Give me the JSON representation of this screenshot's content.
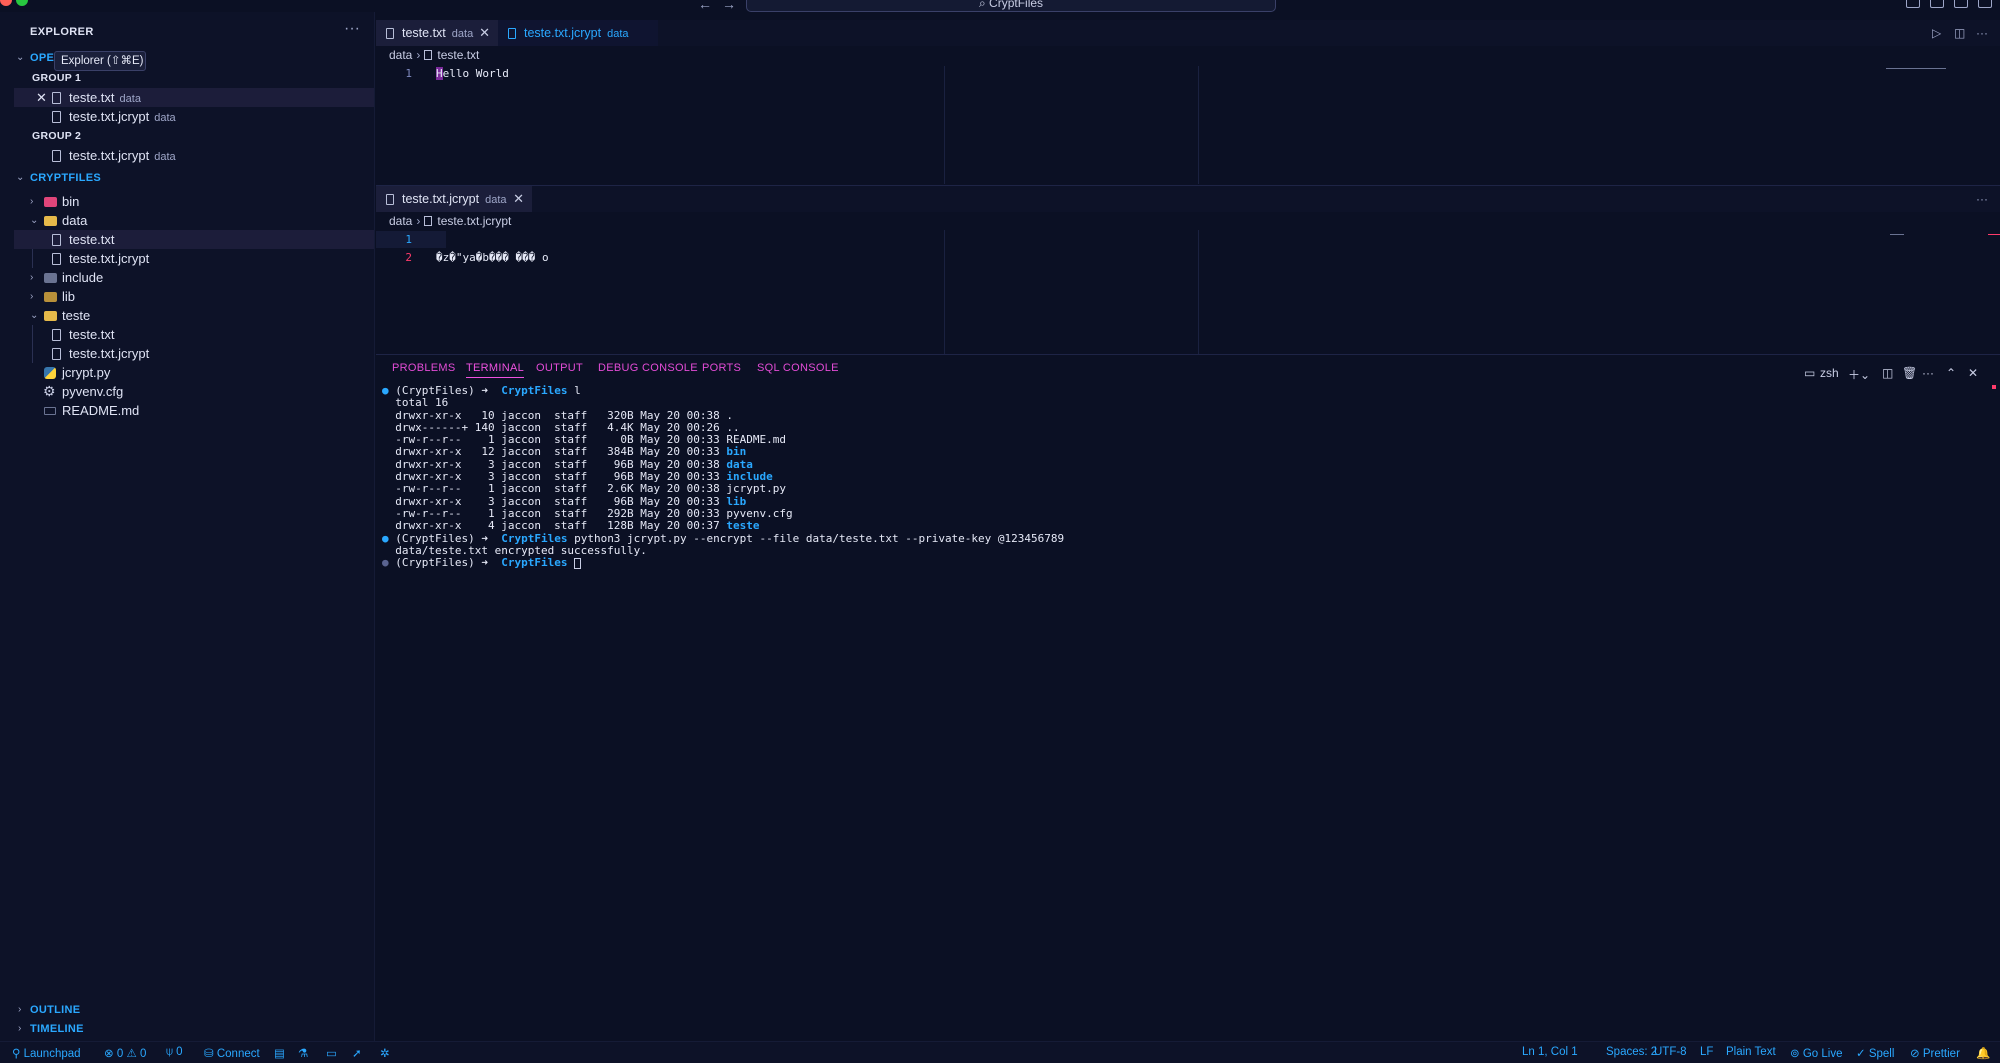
{
  "titlebar": {
    "search": "CryptFiles",
    "back_arrow": "←",
    "forward_arrow": "→"
  },
  "sidebar": {
    "title": "EXPLORER",
    "more": "···",
    "tooltip": "Explorer (⇧⌘E)",
    "open_editors": {
      "title": "OPEN EDITORS",
      "groups": [
        {
          "label": "GROUP 1",
          "items": [
            {
              "name": "teste.txt",
              "desc": "data"
            },
            {
              "name": "teste.txt.jcrypt",
              "desc": "data"
            }
          ]
        },
        {
          "label": "GROUP 2",
          "items": [
            {
              "name": "teste.txt.jcrypt",
              "desc": "data"
            }
          ]
        }
      ]
    },
    "workspace": {
      "title": "CRYPTFILES",
      "items": [
        "bin",
        "data",
        "teste.txt",
        "teste.txt.jcrypt",
        "include",
        "lib",
        "teste",
        "teste.txt",
        "teste.txt.jcrypt",
        "jcrypt.py",
        "pyvenv.cfg",
        "README.md"
      ]
    },
    "outline": "OUTLINE",
    "timeline": "TIMELINE"
  },
  "editor1": {
    "tabs": [
      {
        "name": "teste.txt",
        "desc": "data"
      },
      {
        "name": "teste.txt.jcrypt",
        "desc": "data"
      }
    ],
    "breadcrumb": [
      "data",
      "teste.txt"
    ],
    "lines": [
      {
        "num": "1",
        "text": "Hello World"
      }
    ]
  },
  "editor2": {
    "tabs": [
      {
        "name": "teste.txt.jcrypt",
        "desc": "data"
      }
    ],
    "breadcrumb": [
      "data",
      "teste.txt.jcrypt"
    ],
    "lines": [
      {
        "num": "1",
        "text": ""
      },
      {
        "num": "2",
        "text": "�z�\"ya�b��� ���  o"
      }
    ],
    "more": "···"
  },
  "panel": {
    "tabs": [
      "PROBLEMS",
      "TERMINAL",
      "OUTPUT",
      "DEBUG CONSOLE",
      "PORTS",
      "SQL CONSOLE"
    ],
    "shell": "zsh",
    "terminal": {
      "prompt_env": "(CryptFiles)",
      "prompt_dir": "CryptFiles",
      "cmd1": "l",
      "total": "total 16",
      "listing": [
        {
          "perm": "drwxr-xr-x",
          "links": "10",
          "user": "jaccon",
          "group": "staff",
          "size": "320B",
          "date": "May 20 00:38",
          "name": ".",
          "dir": true
        },
        {
          "perm": "drwx------+",
          "links": "140",
          "user": "jaccon",
          "group": "staff",
          "size": "4.4K",
          "date": "May 20 00:26",
          "name": "..",
          "dir": true
        },
        {
          "perm": "-rw-r--r--",
          "links": "1",
          "user": "jaccon",
          "group": "staff",
          "size": "0B",
          "date": "May 20 00:33",
          "name": "README.md",
          "dir": false
        },
        {
          "perm": "drwxr-xr-x",
          "links": "12",
          "user": "jaccon",
          "group": "staff",
          "size": "384B",
          "date": "May 20 00:33",
          "name": "bin",
          "dir": true
        },
        {
          "perm": "drwxr-xr-x",
          "links": "3",
          "user": "jaccon",
          "group": "staff",
          "size": "96B",
          "date": "May 20 00:38",
          "name": "data",
          "dir": true
        },
        {
          "perm": "drwxr-xr-x",
          "links": "3",
          "user": "jaccon",
          "group": "staff",
          "size": "96B",
          "date": "May 20 00:33",
          "name": "include",
          "dir": true
        },
        {
          "perm": "-rw-r--r--",
          "links": "1",
          "user": "jaccon",
          "group": "staff",
          "size": "2.6K",
          "date": "May 20 00:38",
          "name": "jcrypt.py",
          "dir": false
        },
        {
          "perm": "drwxr-xr-x",
          "links": "3",
          "user": "jaccon",
          "group": "staff",
          "size": "96B",
          "date": "May 20 00:33",
          "name": "lib",
          "dir": true
        },
        {
          "perm": "-rw-r--r--",
          "links": "1",
          "user": "jaccon",
          "group": "staff",
          "size": "292B",
          "date": "May 20 00:33",
          "name": "pyvenv.cfg",
          "dir": false
        },
        {
          "perm": "drwxr-xr-x",
          "links": "4",
          "user": "jaccon",
          "group": "staff",
          "size": "128B",
          "date": "May 20 00:37",
          "name": "teste",
          "dir": true
        }
      ],
      "cmd2": "python3 jcrypt.py --encrypt --file data/teste.txt --private-key @123456789",
      "output": "data/teste.txt encrypted successfully.",
      "arrow": "➜"
    }
  },
  "statusbar": {
    "launchpad": "Launchpad",
    "errors": "0",
    "warnings": "0",
    "ports": "0",
    "connect": "Connect",
    "position": "Ln 1, Col 1",
    "spaces": "Spaces: 2",
    "encoding": "UTF-8",
    "eol": "LF",
    "language": "Plain Text",
    "golive": "Go Live",
    "spell": "Spell",
    "prettier": "Prettier"
  },
  "colors": {
    "background": "#0b1024",
    "accent_blue": "#2aa8ff",
    "accent_pink": "#ef52e0"
  }
}
